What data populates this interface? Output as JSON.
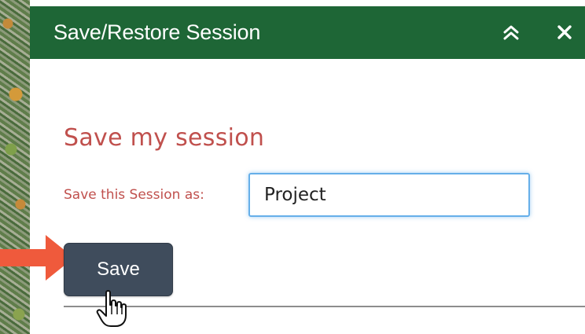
{
  "panel": {
    "title": "Save/Restore Session",
    "collapse_icon": "double-chevron-up-icon",
    "close_icon": "close-icon"
  },
  "save_section": {
    "heading": "Save my session",
    "field_label": "Save this Session as:",
    "field_value": "Project",
    "save_label": "Save"
  },
  "colors": {
    "header_bg": "#1e6636",
    "heading_text": "#c0504d",
    "button_bg": "#3f4c5c",
    "input_focus": "#66afe9",
    "arrow": "#ef5a3c"
  }
}
